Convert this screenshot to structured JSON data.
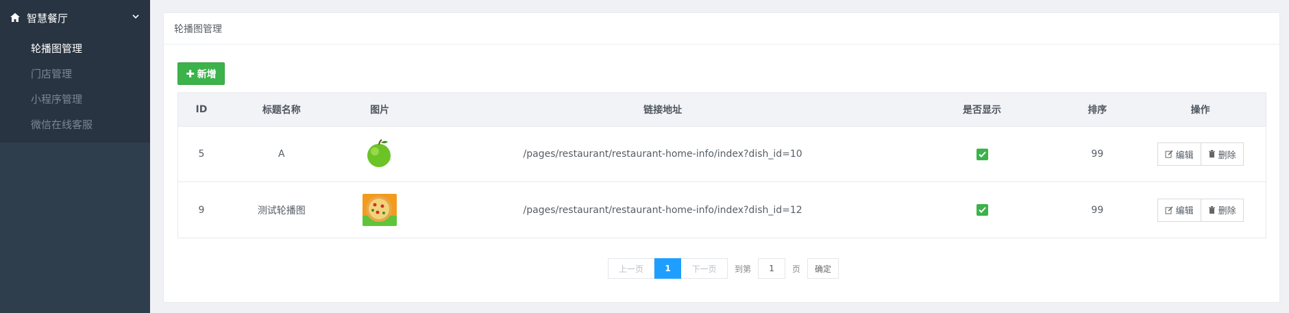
{
  "sidebar": {
    "title": "智慧餐厅",
    "items": [
      {
        "label": "轮播图管理",
        "active": true
      },
      {
        "label": "门店管理",
        "active": false
      },
      {
        "label": "小程序管理",
        "active": false
      },
      {
        "label": "微信在线客服",
        "active": false
      }
    ]
  },
  "panel": {
    "title": "轮播图管理",
    "add_label": "新增"
  },
  "table": {
    "headers": {
      "id": "ID",
      "title": "标题名称",
      "image": "图片",
      "link": "链接地址",
      "show": "是否显示",
      "sort": "排序",
      "op": "操作"
    },
    "rows": [
      {
        "id": "5",
        "title": "A",
        "image": "green-apple-icon",
        "link": "/pages/restaurant/restaurant-home-info/index?dish_id=10",
        "show": true,
        "sort": "99",
        "edit": "编辑",
        "delete": "删除"
      },
      {
        "id": "9",
        "title": "测试轮播图",
        "image": "pizza-icon",
        "link": "/pages/restaurant/restaurant-home-info/index?dish_id=12",
        "show": true,
        "sort": "99",
        "edit": "编辑",
        "delete": "删除"
      }
    ]
  },
  "pager": {
    "prev": "上一页",
    "current": "1",
    "next": "下一页",
    "goto_prefix": "到第",
    "goto_value": "1",
    "goto_suffix": "页",
    "confirm": "确定"
  },
  "colors": {
    "sidebar_bg": "#2f3e4d",
    "accent_green": "#3bb34a",
    "page_active_blue": "#1e9fff"
  }
}
